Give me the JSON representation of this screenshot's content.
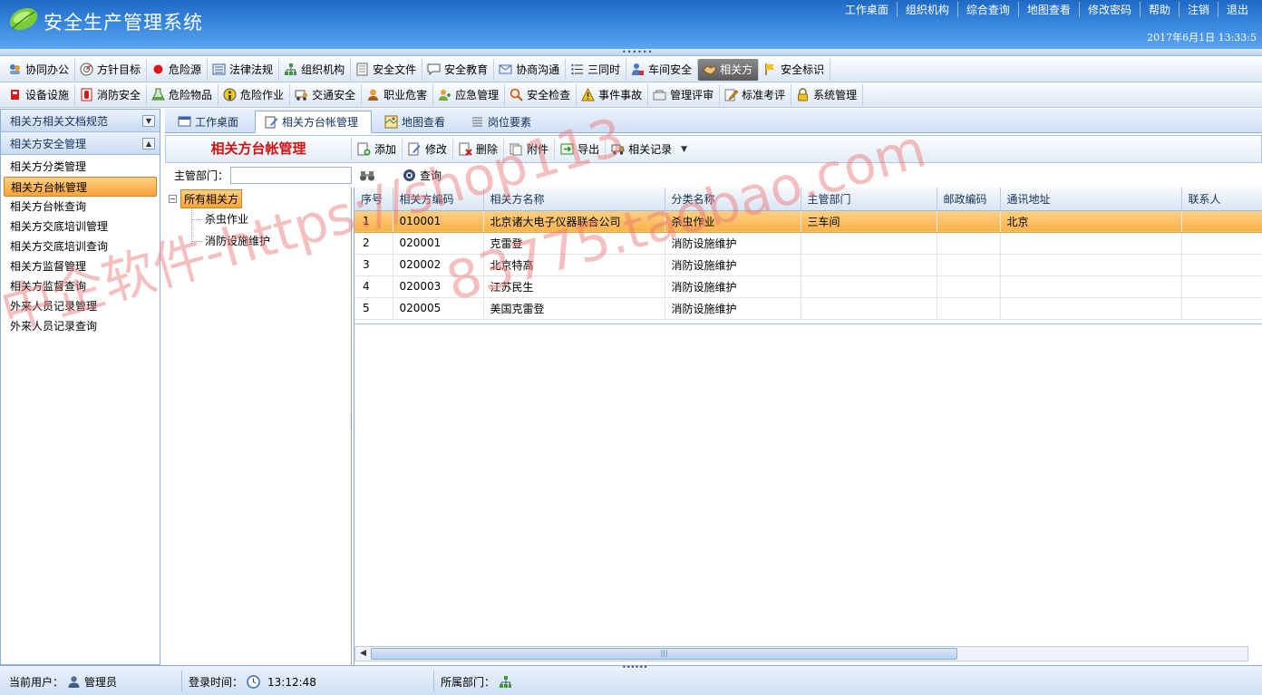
{
  "app": {
    "title": "安全生产管理系统",
    "datetime": "2017年6月1日 13:33:5"
  },
  "header_links": [
    "工作桌面",
    "组织机构",
    "综合查询",
    "地图查看",
    "修改密码",
    "帮助",
    "注销",
    "退出"
  ],
  "menu_row1": [
    {
      "label": "协同办公",
      "icon": "people-handshake-icon"
    },
    {
      "label": "方针目标",
      "icon": "target-icon"
    },
    {
      "label": "危险源",
      "icon": "red-dot-icon"
    },
    {
      "label": "法律法规",
      "icon": "law-book-icon"
    },
    {
      "label": "组织机构",
      "icon": "org-chart-icon"
    },
    {
      "label": "安全文件",
      "icon": "document-icon"
    },
    {
      "label": "安全教育",
      "icon": "comment-icon"
    },
    {
      "label": "协商沟通",
      "icon": "mail-icon"
    },
    {
      "label": "三同时",
      "icon": "list-icon"
    },
    {
      "label": "车间安全",
      "icon": "user-lock-icon"
    },
    {
      "label": "相关方",
      "icon": "handshake-icon",
      "active": true
    },
    {
      "label": "安全标识",
      "icon": "flag-icon"
    }
  ],
  "menu_row2": [
    {
      "label": "设备设施",
      "icon": "device-icon"
    },
    {
      "label": "消防安全",
      "icon": "fire-extinguisher-icon"
    },
    {
      "label": "危险物品",
      "icon": "flask-icon"
    },
    {
      "label": "危险作业",
      "icon": "warning-circle-icon"
    },
    {
      "label": "交通安全",
      "icon": "car-icon"
    },
    {
      "label": "职业危害",
      "icon": "worker-icon"
    },
    {
      "label": "应急管理",
      "icon": "emergency-icon"
    },
    {
      "label": "安全检查",
      "icon": "magnifier-icon"
    },
    {
      "label": "事件事故",
      "icon": "warning-triangle-icon"
    },
    {
      "label": "管理评审",
      "icon": "review-icon"
    },
    {
      "label": "标准考评",
      "icon": "pencil-icon"
    },
    {
      "label": "系统管理",
      "icon": "lock-icon"
    }
  ],
  "sidebar": {
    "sections": [
      {
        "label": "相关方相关文档规范",
        "expanded": false
      },
      {
        "label": "相关方安全管理",
        "expanded": true
      }
    ],
    "items": [
      {
        "label": "相关方分类管理"
      },
      {
        "label": "相关方台帐管理",
        "selected": true
      },
      {
        "label": "相关方台帐查询"
      },
      {
        "label": "相关方交底培训管理"
      },
      {
        "label": "相关方交底培训查询"
      },
      {
        "label": "相关方监督管理"
      },
      {
        "label": "相关方监督查询"
      },
      {
        "label": "外来人员记录管理"
      },
      {
        "label": "外来人员记录查询"
      }
    ]
  },
  "tabs": [
    {
      "label": "工作桌面",
      "icon": "desktop-icon"
    },
    {
      "label": "相关方台帐管理",
      "icon": "edit-doc-icon",
      "active": true
    },
    {
      "label": "地图查看",
      "icon": "map-icon"
    },
    {
      "label": "岗位要素",
      "icon": "lines-icon"
    }
  ],
  "toolbar": {
    "module_title": "相关方台帐管理",
    "buttons": [
      {
        "label": "添加",
        "icon": "add-icon"
      },
      {
        "label": "修改",
        "icon": "edit-icon"
      },
      {
        "label": "删除",
        "icon": "delete-icon"
      },
      {
        "label": "附件",
        "icon": "attachment-icon"
      },
      {
        "label": "导出",
        "icon": "export-icon"
      },
      {
        "label": "相关记录",
        "icon": "truck-icon"
      }
    ]
  },
  "filter": {
    "dept_label": "主管部门：",
    "dept_value": "",
    "query_label": "查询"
  },
  "tree": {
    "root": "所有相关方",
    "children": [
      "杀虫作业",
      "消防设施维护"
    ]
  },
  "grid": {
    "columns": [
      "序号",
      "相关方编码",
      "相关方名称",
      "分类名称",
      "主管部门",
      "邮政编码",
      "通讯地址",
      "联系人"
    ],
    "rows": [
      [
        "1",
        "010001",
        "北京诸大电子仪器联合公司",
        "杀虫作业",
        "三车间",
        "",
        "北京",
        ""
      ],
      [
        "2",
        "020001",
        "克雷登",
        "消防设施维护",
        "",
        "",
        "",
        ""
      ],
      [
        "3",
        "020002",
        "北京特高",
        "消防设施维护",
        "",
        "",
        "",
        ""
      ],
      [
        "4",
        "020003",
        "江苏民生",
        "消防设施维护",
        "",
        "",
        "",
        ""
      ],
      [
        "5",
        "020005",
        "美国克雷登",
        "消防设施维护",
        "",
        "",
        "",
        ""
      ]
    ],
    "selected_row": 0
  },
  "status": {
    "user_label": "当前用户：",
    "user_value": "管理员",
    "login_label": "登录时间：",
    "login_value": "13:12:48",
    "dept_label": "所属部门："
  },
  "watermark": {
    "text_a": "中企软件-https://shop113",
    "text_b": "83775.taobao.com"
  },
  "colors": {
    "header_blue": "#2f7fd8",
    "selection_orange": "#f7a337",
    "module_title_red": "#d21010"
  }
}
